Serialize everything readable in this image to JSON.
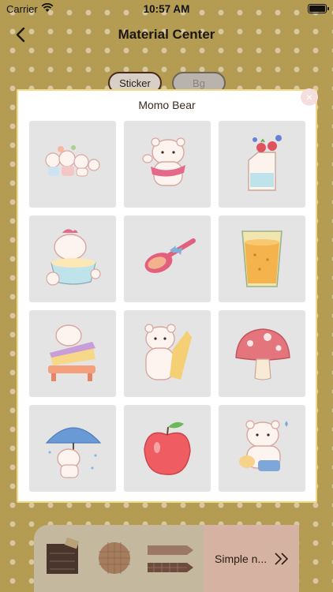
{
  "status_bar": {
    "carrier": "Carrier",
    "time": "10:57 AM"
  },
  "nav": {
    "title": "Material Center",
    "back_icon": "chevron-left-icon"
  },
  "segments": [
    {
      "label": "Sticker",
      "selected": true
    },
    {
      "label": "Bg",
      "selected": false
    }
  ],
  "modal": {
    "title": "Momo Bear",
    "close_icon": "close-icon",
    "stickers": [
      {
        "name": "bear-friends-sticker"
      },
      {
        "name": "bear-waving-sticker"
      },
      {
        "name": "milk-carton-berries-sticker"
      },
      {
        "name": "bear-baking-bowl-sticker"
      },
      {
        "name": "spoon-with-bow-sticker"
      },
      {
        "name": "juice-glass-sticker"
      },
      {
        "name": "bear-on-cake-sticker"
      },
      {
        "name": "bear-with-fan-sticker"
      },
      {
        "name": "mushroom-sticker"
      },
      {
        "name": "bear-with-umbrella-sticker"
      },
      {
        "name": "apple-sticker"
      },
      {
        "name": "bear-with-bag-sticker"
      }
    ]
  },
  "bottom_bar": {
    "category_label": "Simple n...",
    "next_icon": "double-chevron-right-icon"
  },
  "colors": {
    "background": "#b49c52",
    "segment_border": "#4b2a1f",
    "modal_border": "#f2d98a",
    "category_accent": "#d6b2a2"
  }
}
